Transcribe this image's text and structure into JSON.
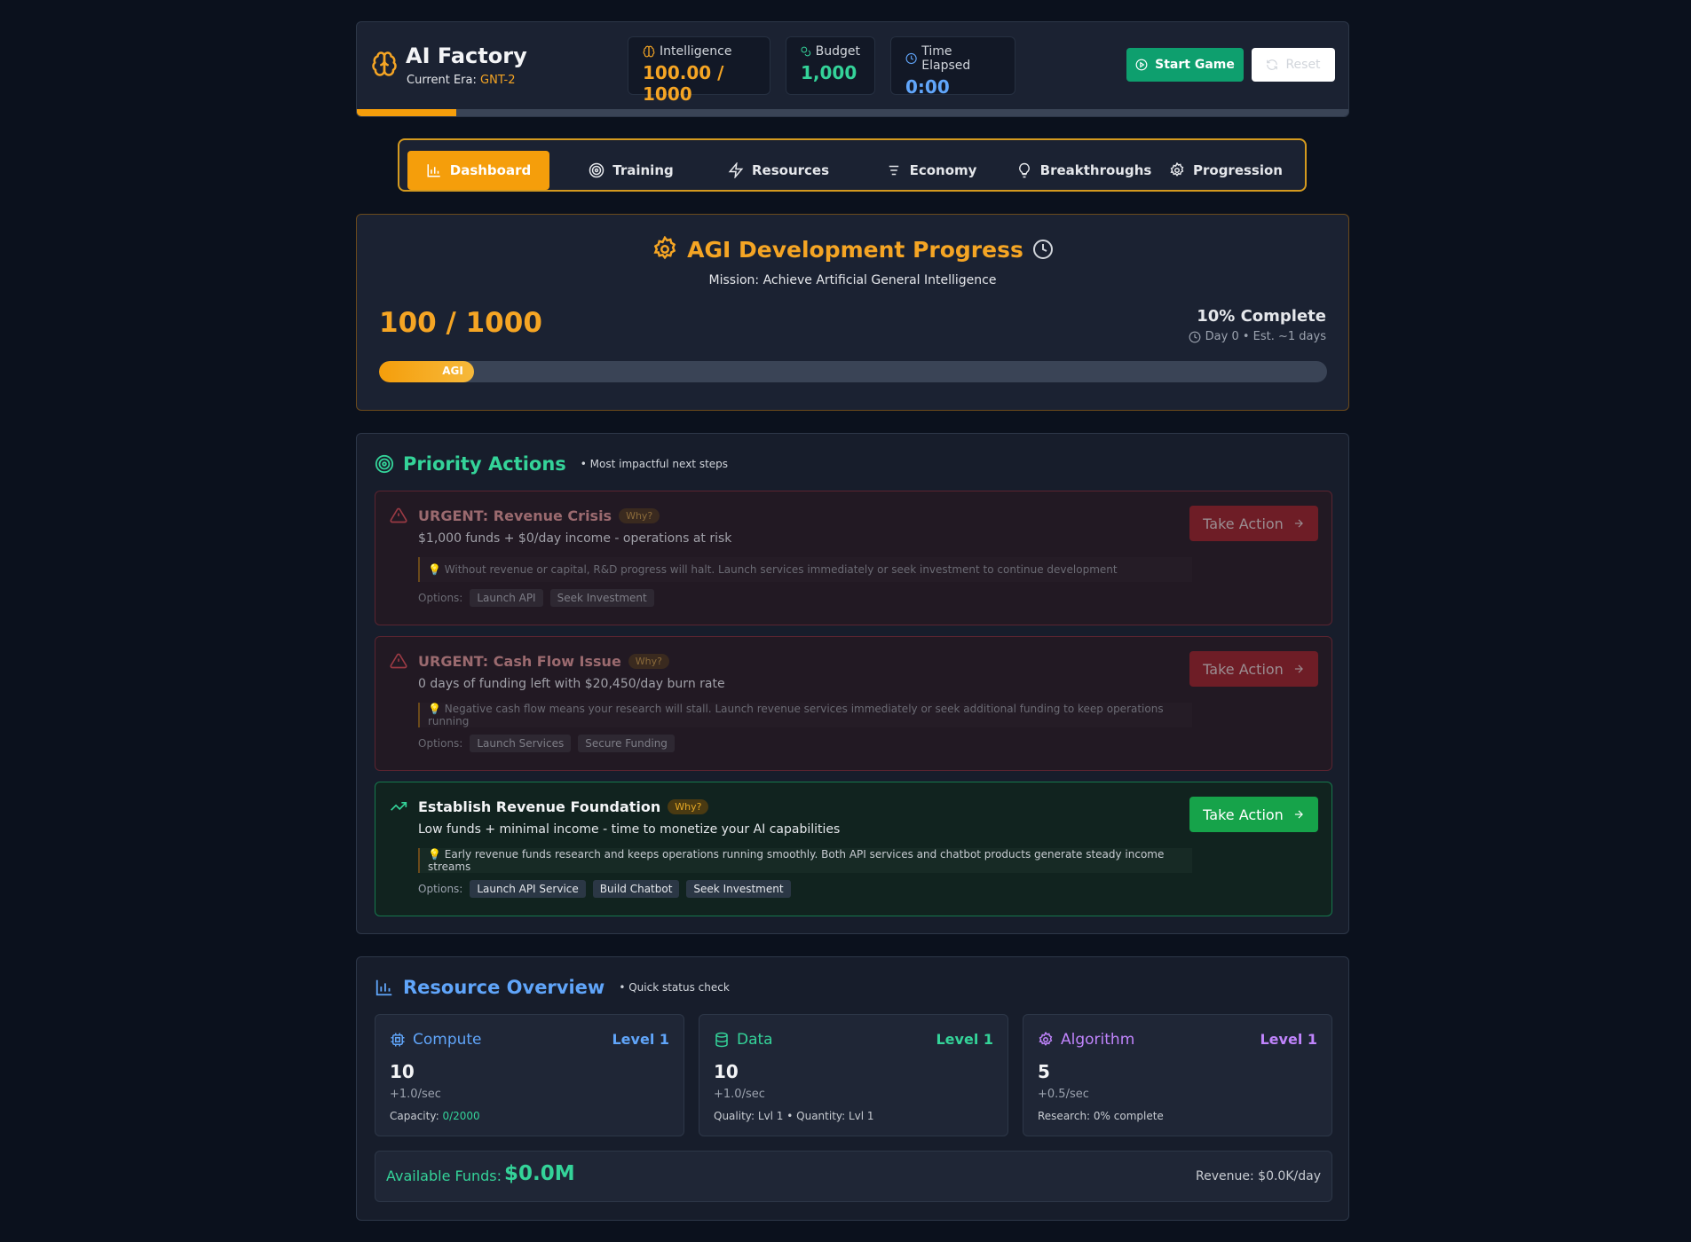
{
  "header": {
    "title": "AI Factory",
    "era_label": "Current Era:",
    "era_value": "GNT-2",
    "stats": [
      {
        "label": "Intelligence",
        "value": "100.00 / 1000",
        "color": "#f5a524",
        "icon": "brain-icon"
      },
      {
        "label": "Budget",
        "value": "1,000",
        "color": "#34d399",
        "icon": "coins-icon"
      },
      {
        "label": "Time Elapsed",
        "value": "0:00",
        "color": "#60a5fa",
        "icon": "clock-icon"
      }
    ],
    "start_label": "Start Game",
    "reset_label": "Reset",
    "progress": 0.1
  },
  "tabs": [
    {
      "label": "Dashboard",
      "icon": "bar-chart-icon",
      "active": true
    },
    {
      "label": "Training",
      "icon": "target-icon",
      "active": false
    },
    {
      "label": "Resources",
      "icon": "lightning-icon",
      "active": false
    },
    {
      "label": "Economy",
      "icon": "list-icon",
      "active": false
    },
    {
      "label": "Breakthroughs",
      "icon": "lightbulb-icon",
      "active": false
    },
    {
      "label": "Progression",
      "icon": "gear-icon",
      "active": false
    }
  ],
  "agi": {
    "title": "AGI Development Progress",
    "mission": "Mission: Achieve Artificial General Intelligence",
    "value": "100 / 1000",
    "percent": "10% Complete",
    "estimate": "Day 0 • Est. ~1 days",
    "bar_label": "AGI",
    "progress": 0.1
  },
  "priority": {
    "title": "Priority Actions",
    "subtitle": "• Most impactful next steps",
    "options_label": "Options:",
    "why_label": "Why?",
    "take_action_label": "Take Action",
    "cards": [
      {
        "kind": "urgent",
        "title": "URGENT: Revenue Crisis",
        "desc": "$1,000 funds + $0/day income - operations at risk",
        "tip": "💡 Without revenue or capital, R&D progress will halt. Launch services immediately or seek investment to continue development",
        "options": [
          "Launch API",
          "Seek Investment"
        ]
      },
      {
        "kind": "urgent",
        "title": "URGENT: Cash Flow Issue",
        "desc": "0 days of funding left with $20,450/day burn rate",
        "tip": "💡 Negative cash flow means your research will stall. Launch revenue services immediately or seek additional funding to keep operations running",
        "options": [
          "Launch Services",
          "Secure Funding"
        ]
      },
      {
        "kind": "good",
        "title": "Establish Revenue Foundation",
        "desc": "Low funds + minimal income - time to monetize your AI capabilities",
        "tip": "💡 Early revenue funds research and keeps operations running smoothly. Both API services and chatbot products generate steady income streams",
        "options": [
          "Launch API Service",
          "Build Chatbot",
          "Seek Investment"
        ]
      }
    ]
  },
  "resources": {
    "title": "Resource Overview",
    "subtitle": "• Quick status check",
    "cards": [
      {
        "name": "Compute",
        "level": "Level 1",
        "amount": "10",
        "rate": "+1.0/sec",
        "meta": "Capacity: ",
        "meta_value": "0/2000",
        "color": "#60a5fa",
        "icon": "cpu-icon"
      },
      {
        "name": "Data",
        "level": "Level 1",
        "amount": "10",
        "rate": "+1.0/sec",
        "meta": "Quality: Lvl 1 • Quantity: Lvl 1",
        "meta_value": "",
        "color": "#34d399",
        "icon": "database-icon"
      },
      {
        "name": "Algorithm",
        "level": "Level 1",
        "amount": "5",
        "rate": "+0.5/sec",
        "meta": "Research: 0% complete",
        "meta_value": "",
        "color": "#c084fc",
        "icon": "gear-icon"
      }
    ],
    "funds_label": "Available Funds:",
    "funds_value": "$0.0M",
    "revenue": "Revenue: $0.0K/day"
  }
}
